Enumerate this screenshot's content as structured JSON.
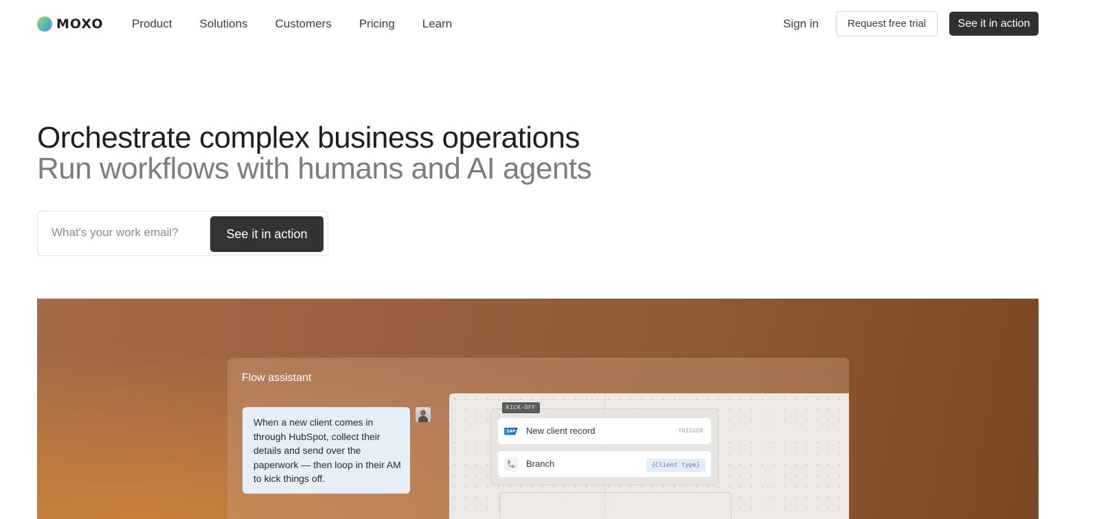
{
  "brand": {
    "name": "MOXO"
  },
  "nav": {
    "links": [
      "Product",
      "Solutions",
      "Customers",
      "Pricing",
      "Learn"
    ],
    "sign_in": "Sign in",
    "trial": "Request free trial",
    "action": "See it in action"
  },
  "hero": {
    "headline": "Orchestrate complex business operations",
    "subheadline": "Run workflows with humans and AI agents",
    "email_placeholder": "What's your work email?",
    "cta": "See it in action"
  },
  "showcase": {
    "panel_title": "Flow assistant",
    "message": "When a new client comes in through HubSpot, collect their details and send over the paperwork — then loop in their AM to kick things off.",
    "kickoff_label": "KICK-OFF",
    "nodes": [
      {
        "label": "New client record",
        "tag": "TRIGGER",
        "icon": "sap-icon"
      },
      {
        "label": "Branch",
        "tag": "{Client type}",
        "icon": "branch-icon"
      }
    ]
  }
}
